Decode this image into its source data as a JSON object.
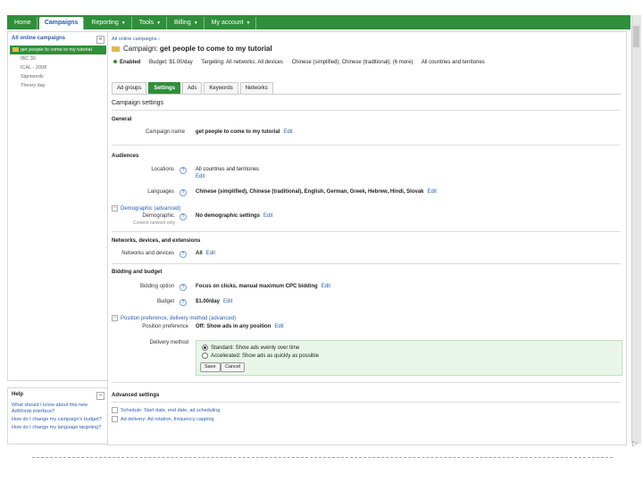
{
  "nav": {
    "tabs": [
      {
        "label": "Home",
        "active": false,
        "caret": false
      },
      {
        "label": "Campaigns",
        "active": true,
        "caret": false
      },
      {
        "label": "Reporting",
        "active": false,
        "caret": true
      },
      {
        "label": "Tools",
        "active": false,
        "caret": true
      },
      {
        "label": "Billing",
        "active": false,
        "caret": true
      },
      {
        "label": "My account",
        "active": false,
        "caret": true
      }
    ],
    "caret_glyph": "▼"
  },
  "sidebar": {
    "title": "All online campaigns",
    "box_glyph": "«",
    "items": [
      {
        "label": "get people to come to my tutorial",
        "selected": true
      },
      {
        "label": "IBC 30",
        "selected": false
      },
      {
        "label": "ICAL - 2008",
        "selected": false
      },
      {
        "label": "Signwords",
        "selected": false
      },
      {
        "label": "Theory day",
        "selected": false
      }
    ]
  },
  "help": {
    "title": "Help",
    "box_glyph": "–",
    "links": [
      "What should I know about this new AdWords interface?",
      "How do I change my campaign's budget?",
      "How do I change my language targeting?"
    ]
  },
  "main": {
    "breadcrumb": "All online campaigns ›",
    "campaign_prefix": "Campaign:",
    "campaign_name": "get people to come to my tutorial",
    "status": {
      "state": "Enabled",
      "budget": "Budget: $1.00/day",
      "targeting": "Targeting: All networks; All devices",
      "languages": "Chinese (simplified); Chinese (traditional); (6 more)",
      "locations": "All countries and territories"
    },
    "subtabs": [
      {
        "label": "Ad groups",
        "active": false
      },
      {
        "label": "Settings",
        "active": true
      },
      {
        "label": "Ads",
        "active": false
      },
      {
        "label": "Keywords",
        "active": false
      },
      {
        "label": "Networks",
        "active": false
      }
    ],
    "panel_title": "Campaign settings",
    "edit_label": "Edit",
    "general": {
      "heading": "General",
      "name_label": "Campaign name",
      "name_value": "get people to come to my tutorial"
    },
    "audiences": {
      "heading": "Audiences",
      "locations_label": "Locations",
      "locations_value": "All countries and territories",
      "languages_label": "Languages",
      "languages_value": "Chinese (simplified), Chinese (traditional), English, German, Greek, Hebrew, Hindi, Slovak",
      "demographic_toggle": "Demographic (advanced)",
      "demographic_label": "Demographic",
      "demographic_sublabel": "Content network only",
      "demographic_value": "No demographic settings"
    },
    "networks": {
      "heading": "Networks, devices, and extensions",
      "label": "Networks and devices",
      "value": "All"
    },
    "bidding": {
      "heading": "Bidding and budget",
      "option_label": "Bidding option",
      "option_value": "Focus on clicks, manual maximum CPC bidding",
      "budget_label": "Budget",
      "budget_value": "$1.00/day",
      "position_toggle": "Position preference, delivery method (advanced)",
      "position_label": "Position preference",
      "position_value": "Off: Show ads in any position",
      "delivery_label": "Delivery method",
      "delivery_options": [
        {
          "label": "Standard: Show ads evenly over time",
          "checked": true
        },
        {
          "label": "Accelerated: Show ads as quickly as possible",
          "checked": false
        }
      ],
      "save_label": "Save",
      "cancel_label": "Cancel"
    },
    "advanced": {
      "heading": "Advanced settings",
      "links": [
        "Schedule: Start date, end date, ad scheduling",
        "Ad delivery: Ad rotation, frequency capping"
      ]
    }
  },
  "scrollbar": {
    "arrow_glyph": "▷"
  },
  "colors": {
    "brand_green": "#2f8f3a",
    "link_blue": "#2a5db0",
    "delivery_bg": "#e9f5e9"
  }
}
